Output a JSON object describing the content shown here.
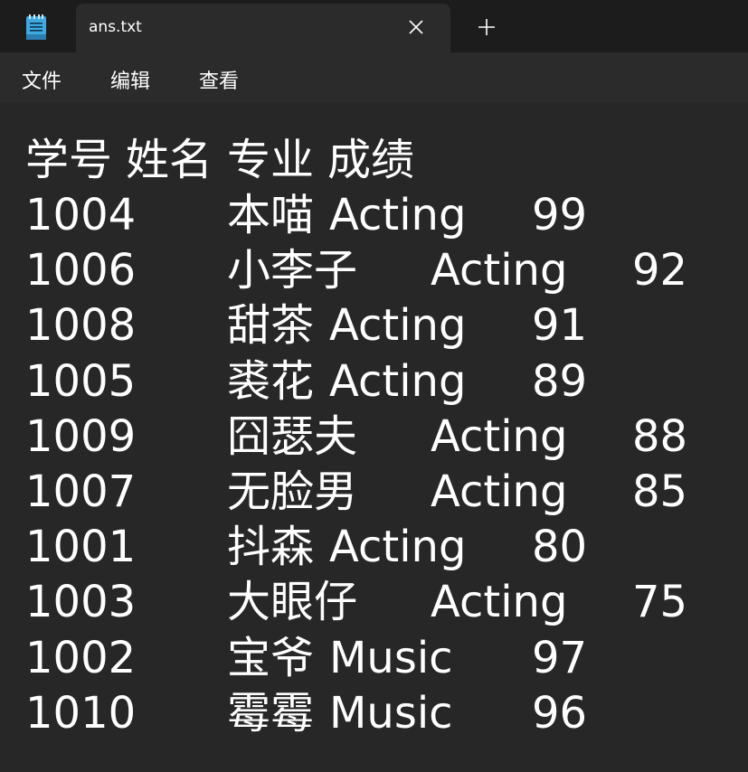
{
  "tab": {
    "title": "ans.txt"
  },
  "icons": {
    "app": "notepad-icon",
    "close": "close-icon",
    "add": "plus-icon"
  },
  "menu": [
    "文件",
    "编辑",
    "查看"
  ],
  "header": [
    "学号",
    "姓名",
    "专业",
    "成绩"
  ],
  "rows": [
    {
      "id": "1004",
      "name": "本喵",
      "major": "Acting",
      "score": "99",
      "wide": false
    },
    {
      "id": "1006",
      "name": "小李子",
      "major": "Acting",
      "score": "92",
      "wide": true
    },
    {
      "id": "1008",
      "name": "甜茶",
      "major": "Acting",
      "score": "91",
      "wide": false
    },
    {
      "id": "1005",
      "name": "裘花",
      "major": "Acting",
      "score": "89",
      "wide": false
    },
    {
      "id": "1009",
      "name": "囧瑟夫",
      "major": "Acting",
      "score": "88",
      "wide": true
    },
    {
      "id": "1007",
      "name": "无脸男",
      "major": "Acting",
      "score": "85",
      "wide": true
    },
    {
      "id": "1001",
      "name": "抖森",
      "major": "Acting",
      "score": "80",
      "wide": false
    },
    {
      "id": "1003",
      "name": "大眼仔",
      "major": "Acting",
      "score": "75",
      "wide": true
    },
    {
      "id": "1002",
      "name": "宝爷",
      "major": "Music",
      "score": "97",
      "wide": false
    },
    {
      "id": "1010",
      "name": "霉霉",
      "major": "Music",
      "score": "96",
      "wide": false
    }
  ],
  "colors": {
    "titlebar": "#1c1c1c",
    "tab": "#2b2b2b",
    "editor": "#272727",
    "text": "#ffffff",
    "icon_blue": "#3fa9e0"
  }
}
